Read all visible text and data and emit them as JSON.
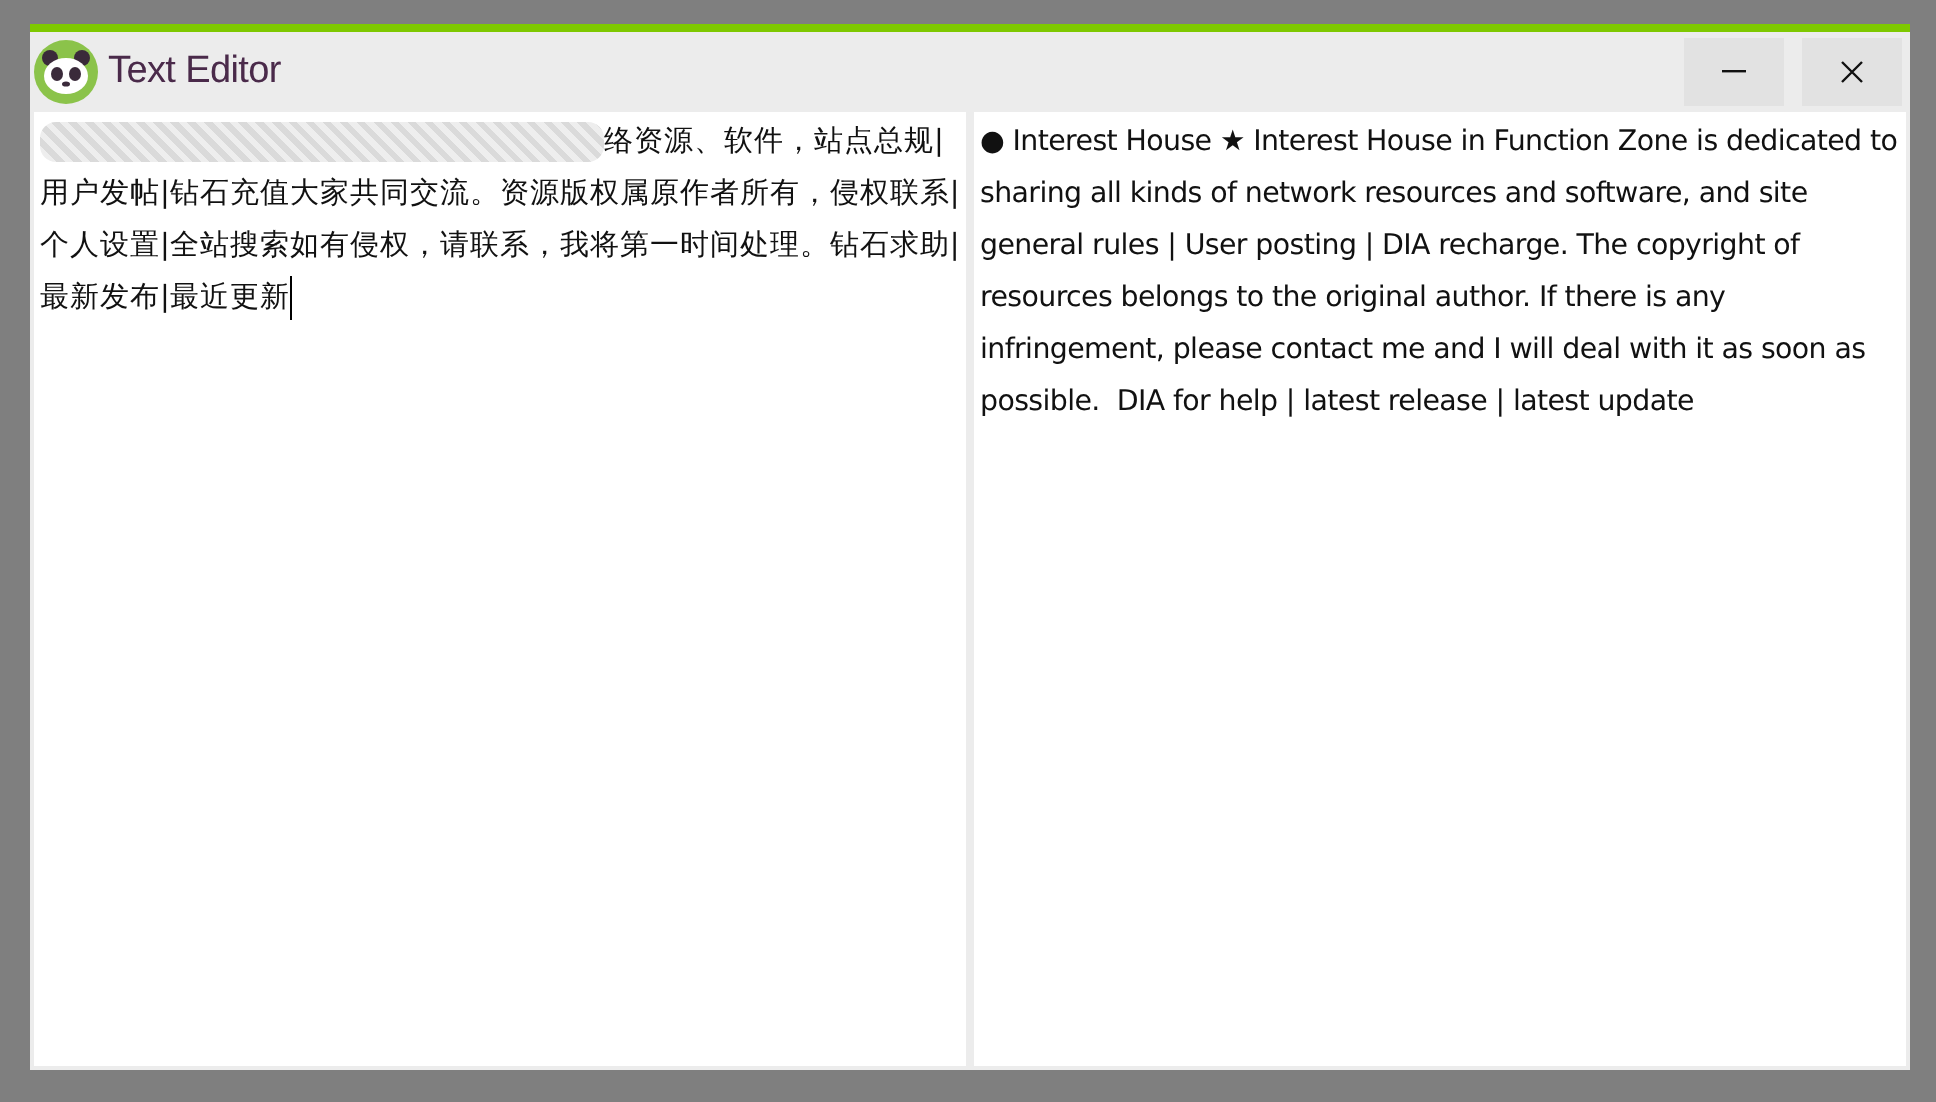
{
  "window": {
    "title": "Text Editor",
    "buttons": [
      {
        "kind": "minimize"
      },
      {
        "kind": "close"
      }
    ]
  },
  "left_editor": {
    "lines": [
      "络资源、软件，站点总规|",
      "用户发帖|钻石充值大家共同交流。资源版权属原作者所有，侵权联系|",
      "个人设置|全站搜索如有侵权，请联系，我将第一时间处理。钻石求助|",
      "最新发布|最近更新"
    ],
    "first_line_obscured": true
  },
  "right_editor": {
    "text": "● Interest House ★ Interest House in Function Zone is dedicated to sharing all kinds of network resources and software, and site general rules | User posting | DIA recharge. The copyright of resources belongs to the original author. If there is any infringement, please contact me and I will deal with it as soon as possible.  DIA for help | latest release | latest update"
  }
}
